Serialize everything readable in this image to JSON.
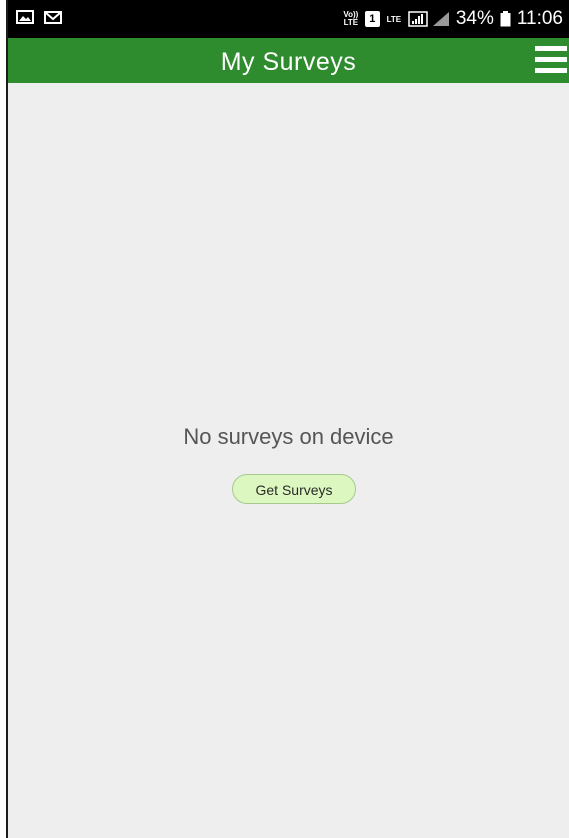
{
  "status_bar": {
    "left_icons": [
      "image-icon",
      "mail-icon"
    ],
    "volte_label": "Vo)) LTE",
    "sim_label": "1",
    "lte_label": "LTE",
    "battery_percent": "34%",
    "time": "11:06"
  },
  "header": {
    "title": "My Surveys",
    "menu_icon": "hamburger-menu-icon",
    "background_color": "#2e8b2e"
  },
  "main": {
    "empty_message": "No surveys on device",
    "get_surveys_label": "Get Surveys",
    "background_color": "#eeeeee",
    "button_color": "#dcf7bf"
  }
}
